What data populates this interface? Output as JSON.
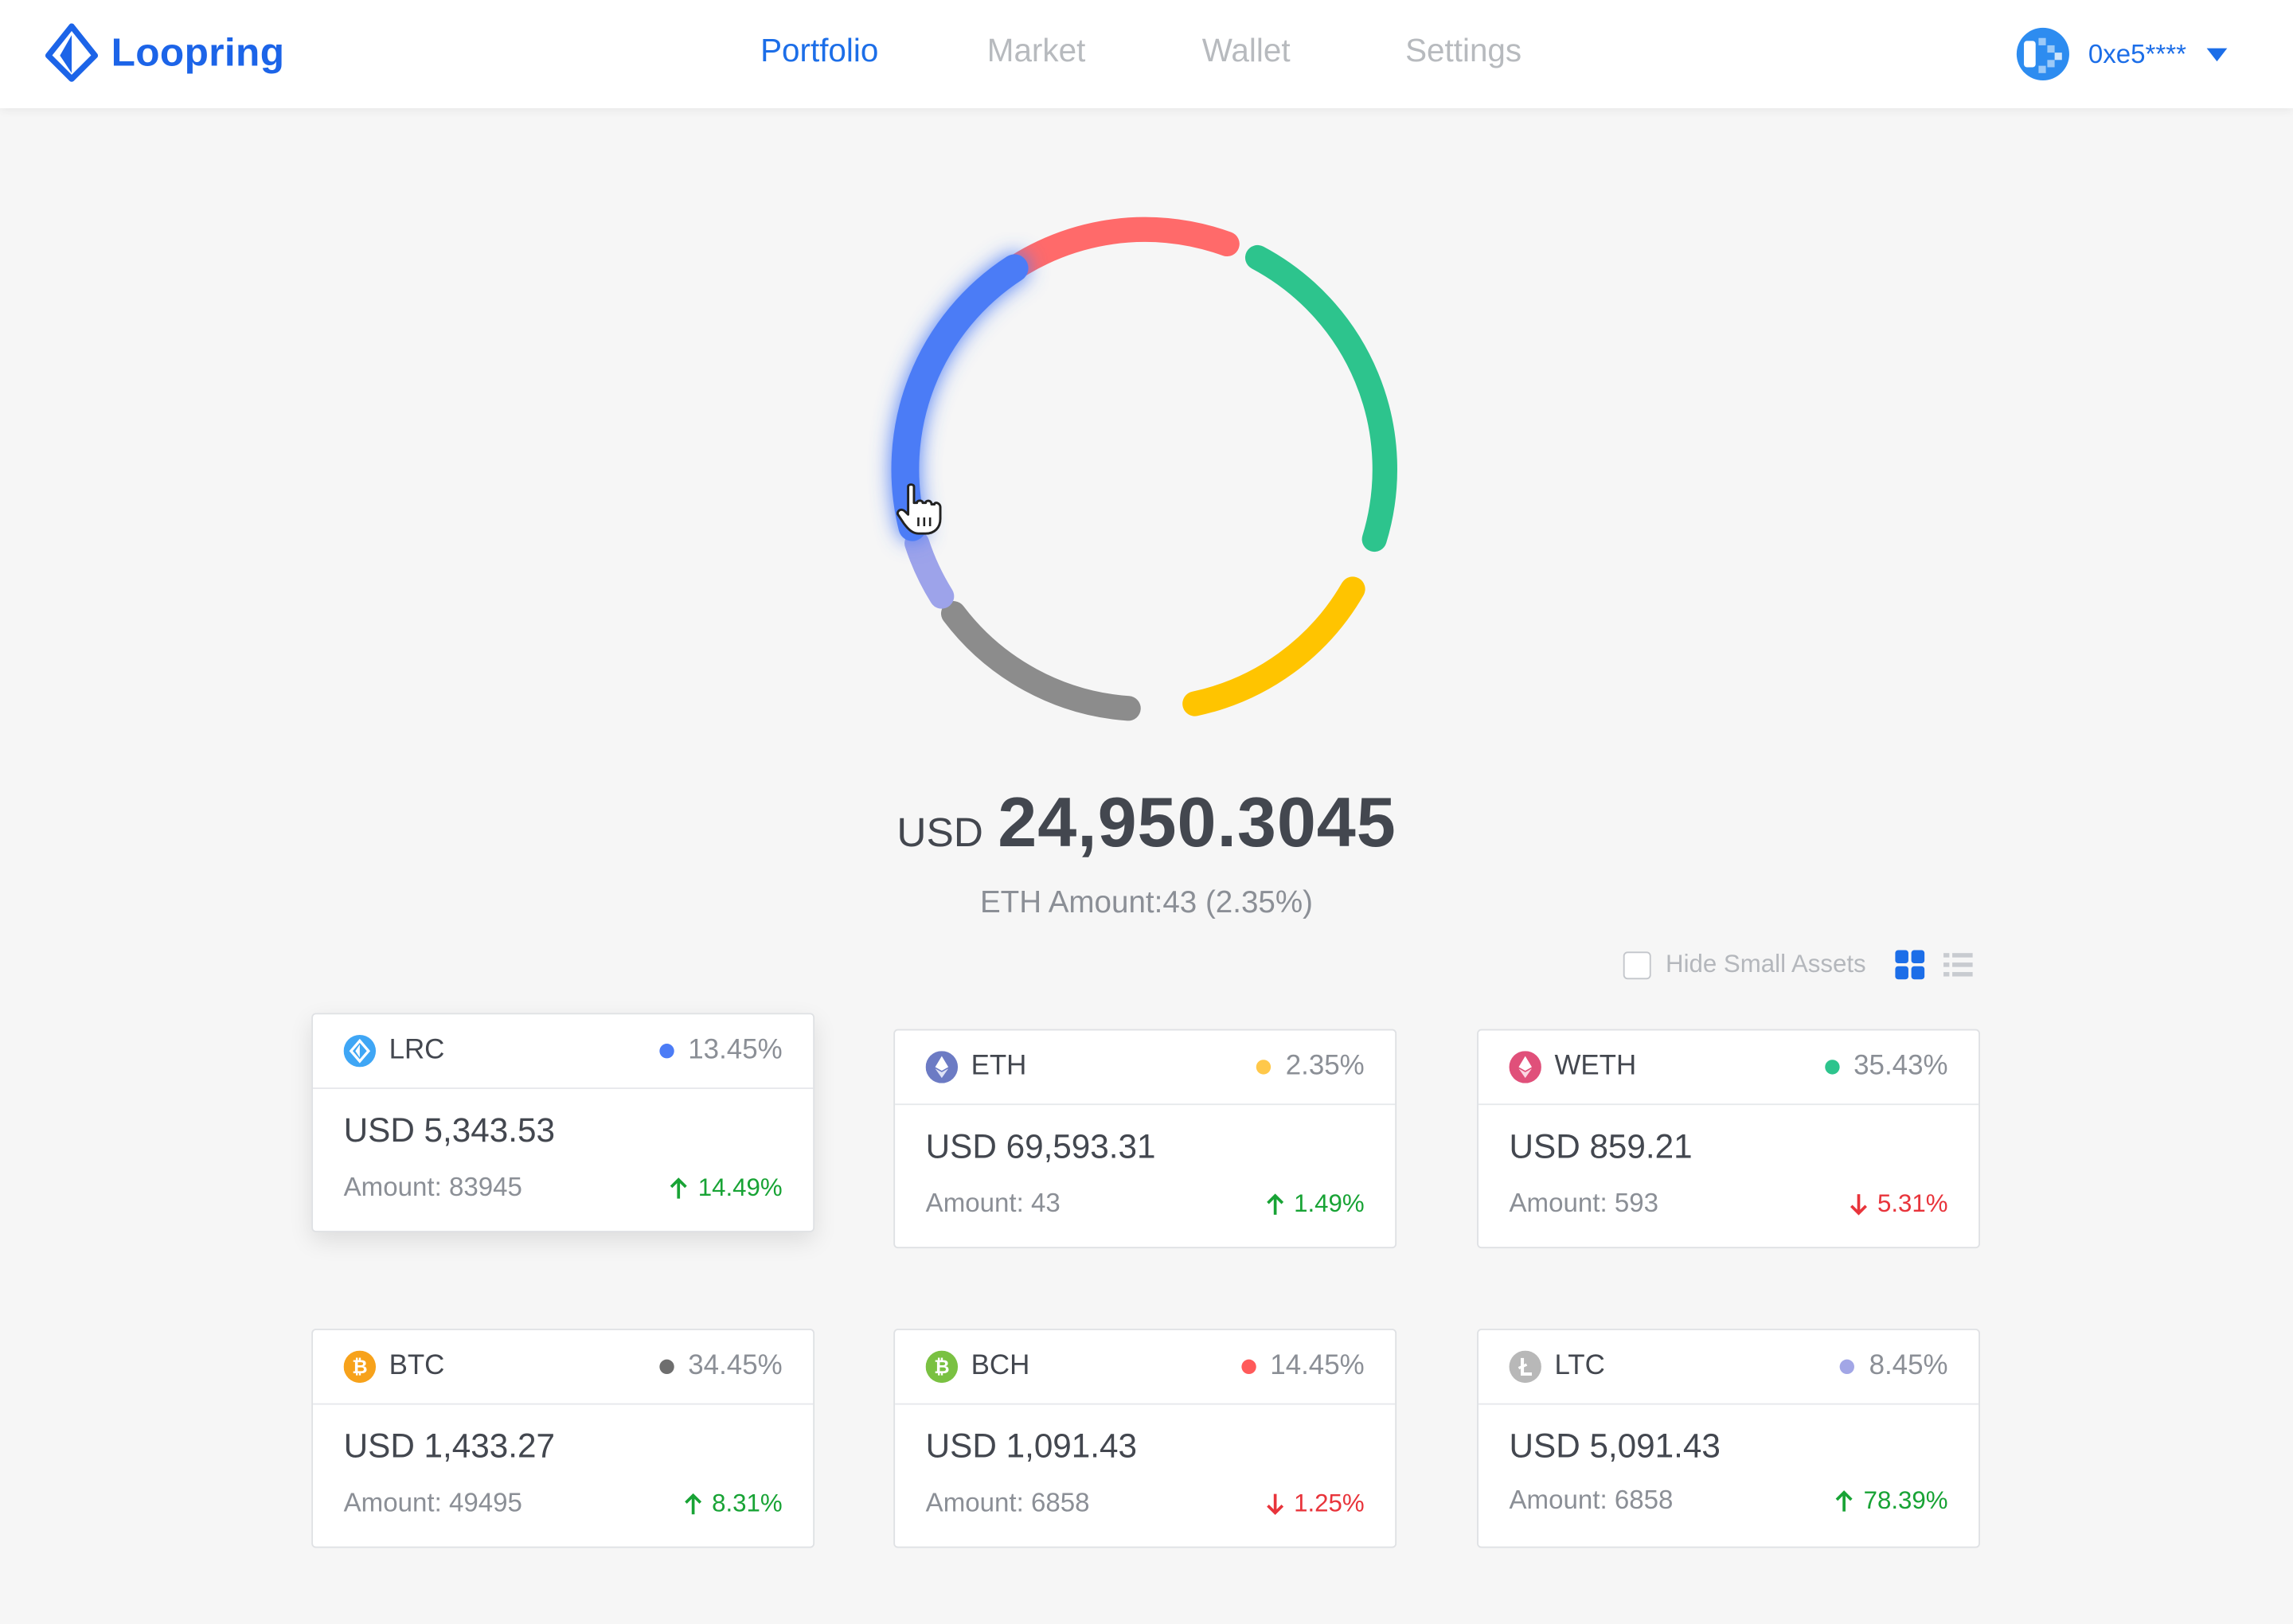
{
  "header": {
    "brand": "Loopring",
    "nav": [
      {
        "label": "Portfolio",
        "active": true
      },
      {
        "label": "Market",
        "active": false
      },
      {
        "label": "Wallet",
        "active": false
      },
      {
        "label": "Settings",
        "active": false
      }
    ],
    "account": "0xe5****"
  },
  "colors": {
    "accent": "#1c6ee8",
    "up": "#18a335",
    "down": "#e8343b"
  },
  "chart_data": {
    "type": "pie",
    "style": "donut",
    "segments": [
      {
        "color": "#ff6a6a"
      },
      {
        "color": "#2dc48d"
      },
      {
        "color": "#ffc400"
      },
      {
        "color": "#8c8c8c"
      },
      {
        "color": "#9da3ea"
      },
      {
        "color": "#4c7cf6"
      }
    ]
  },
  "summary": {
    "currency": "USD",
    "total": "24,950.3045",
    "subline": "ETH Amount:43 (2.35%)"
  },
  "controls": {
    "hide_small_label": "Hide Small Assets",
    "hide_small_checked": false,
    "view_mode": "grid"
  },
  "cards": [
    {
      "symbol": "LRC",
      "share": "13.45%",
      "dot": "#4c7cf6",
      "value": "USD 5,343.53",
      "amount": "Amount: 83945",
      "change": "14.49%",
      "dir": "up",
      "icon": "lrc-icon"
    },
    {
      "symbol": "ETH",
      "share": "2.35%",
      "dot": "#ffc84a",
      "value": "USD 69,593.31",
      "amount": "Amount: 43",
      "change": "1.49%",
      "dir": "up",
      "icon": "eth-icon"
    },
    {
      "symbol": "WETH",
      "share": "35.43%",
      "dot": "#2dc48d",
      "value": "USD 859.21",
      "amount": "Amount: 593",
      "change": "5.31%",
      "dir": "down",
      "icon": "weth-icon"
    },
    {
      "symbol": "BTC",
      "share": "34.45%",
      "dot": "#6e6e6e",
      "value": "USD 1,433.27",
      "amount": "Amount: 49495",
      "change": "8.31%",
      "dir": "up",
      "icon": "btc-icon"
    },
    {
      "symbol": "BCH",
      "share": "14.45%",
      "dot": "#ff5a5a",
      "value": "USD 1,091.43",
      "amount": "Amount: 6858",
      "change": "1.25%",
      "dir": "down",
      "icon": "bch-icon"
    },
    {
      "symbol": "LTC",
      "share": "8.45%",
      "dot": "#a2a6e6",
      "value": "USD 5,091.43",
      "amount": "Amount: 6858",
      "change": "78.39%",
      "dir": "up",
      "icon": "ltc-icon"
    }
  ]
}
